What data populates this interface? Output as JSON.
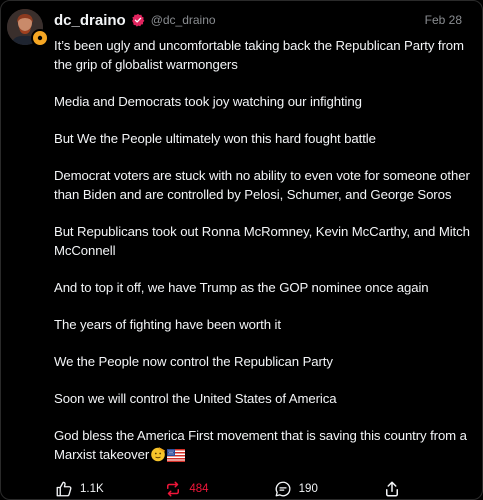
{
  "post": {
    "username": "dc_draino",
    "handle": "@dc_draino",
    "date": "Feb 28",
    "paragraphs": [
      "It’s been ugly and uncomfortable taking back the Republican Party from the grip of globalist warmongers",
      "Media and Democrats took joy watching our infighting",
      "But We the People ultimately won this hard fought battle",
      "Democrat voters are stuck with no ability to even vote for someone other than Biden and are controlled by Pelosi, Schumer, and George Soros",
      "But Republicans took out Ronna McRomney, Kevin McCarthy, and Mitch McConnell",
      "And to top it off, we have Trump as the GOP nominee once again",
      "The years of fighting have been worth it",
      "We the People now control the Republican Party",
      "Soon we will control the United States of America"
    ],
    "final_paragraph": "God bless the America First movement that is saving this country from a Marxist takeover",
    "final_emojis": [
      "saluting-face-emoji",
      "us-flag-emoji"
    ]
  },
  "actions": {
    "likes": "1.1K",
    "reposts": "484",
    "comments": "190"
  },
  "colors": {
    "background": "#000000",
    "text": "#f3f5f7",
    "muted": "#8a8d91",
    "repost_accent": "#f0163a",
    "verified": "#e0245e"
  },
  "icons": {
    "verified": "verified-badge-icon",
    "like": "thumbs-up-icon",
    "repost": "repost-icon",
    "comment": "comment-bubble-icon",
    "share": "share-icon"
  }
}
